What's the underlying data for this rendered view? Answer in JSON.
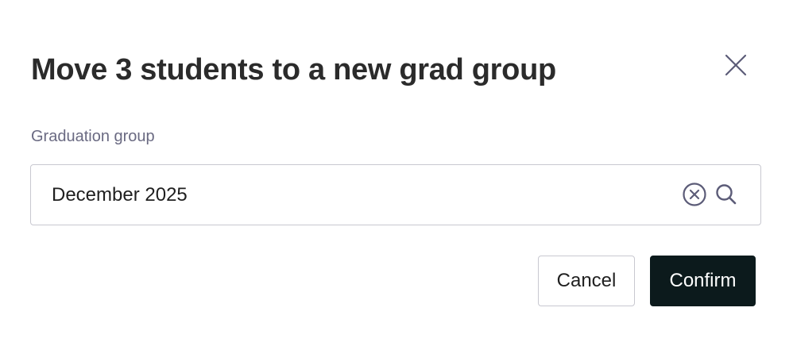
{
  "dialog": {
    "title": "Move 3 students to a new grad group"
  },
  "field": {
    "label": "Graduation group",
    "value": "December 2025"
  },
  "actions": {
    "cancel_label": "Cancel",
    "confirm_label": "Confirm"
  },
  "icons": {
    "close": "close-icon",
    "clear": "clear-circle-icon",
    "search": "search-icon"
  },
  "colors": {
    "title": "#2b2b2b",
    "label": "#6a6a82",
    "icon": "#5c5c78",
    "border": "#c8c8d0",
    "primary": "#0c1a1c"
  }
}
